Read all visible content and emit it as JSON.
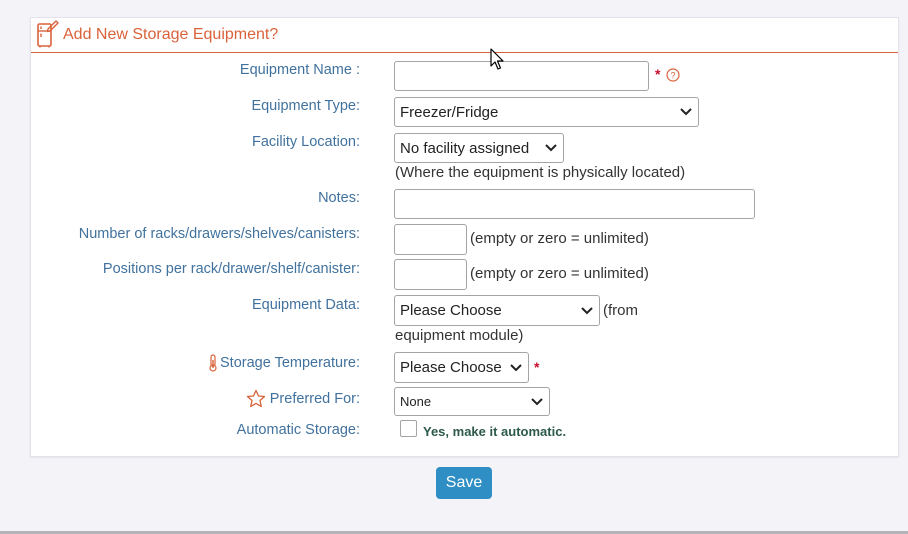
{
  "panel": {
    "title": "Add New Storage Equipment?",
    "icon": "fridge-edit-icon",
    "accent_color": "#d9623a"
  },
  "form": {
    "equipment_name": {
      "label": "Equipment Name :",
      "value": "",
      "required_mark": "*",
      "help_icon": "question-circle-icon"
    },
    "equipment_type": {
      "label": "Equipment Type:",
      "value": "Freezer/Fridge"
    },
    "facility_location": {
      "label": "Facility Location:",
      "value": "No facility assigned",
      "note": "(Where the equipment is physically located)"
    },
    "notes": {
      "label": "Notes:",
      "value": ""
    },
    "racks": {
      "label": "Number of racks/drawers/shelves/canisters:",
      "value": "",
      "hint": "(empty or zero = unlimited)"
    },
    "positions": {
      "label": "Positions per rack/drawer/shelf/canister:",
      "value": "",
      "hint": "(empty or zero = unlimited)"
    },
    "equipment_data": {
      "label": "Equipment Data:",
      "value": "Please Choose",
      "hint_line1": "(from",
      "hint_line2": "equipment module)"
    },
    "storage_temperature": {
      "label": "Storage Temperature:",
      "value": "Please Choose",
      "required_mark": "*",
      "icon": "thermometer-icon"
    },
    "preferred_for": {
      "label": "Preferred For:",
      "value": "None",
      "icon": "star-outline-icon"
    },
    "automatic_storage": {
      "label": "Automatic Storage:",
      "checked": false,
      "checkbox_label": "Yes, make it automatic."
    }
  },
  "actions": {
    "save_label": "Save",
    "save_color": "#2f8fc4"
  }
}
